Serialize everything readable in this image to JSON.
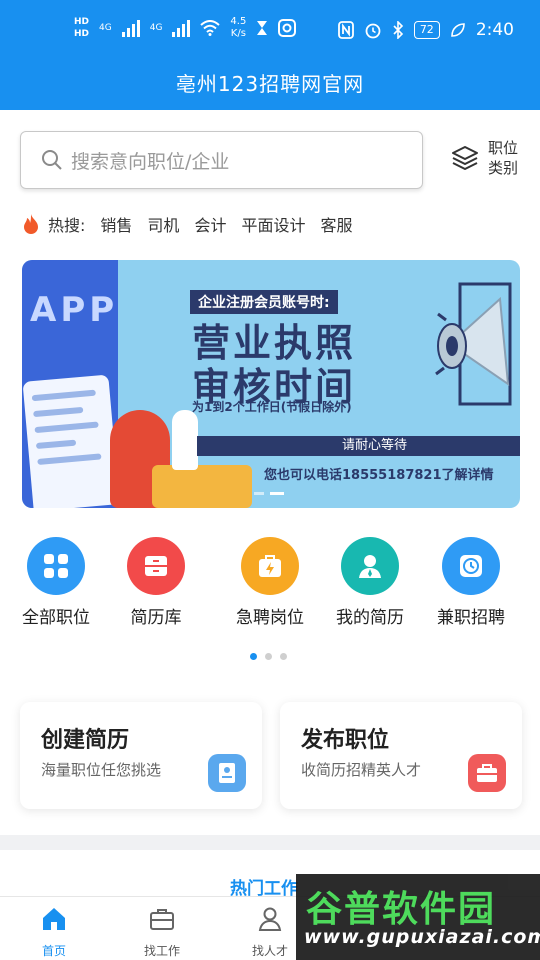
{
  "status_bar": {
    "hd1": "HD",
    "hd2": "HD",
    "net1": "4G",
    "net2": "4G",
    "speed_value": "4.5",
    "speed_unit": "K/s",
    "battery": "72",
    "time": "2:40"
  },
  "app_title": "亳州123招聘网官网",
  "search": {
    "placeholder": "搜索意向职位/企业"
  },
  "category_button": {
    "line1": "职位",
    "line2": "类别"
  },
  "hot_search": {
    "label": "热搜:",
    "tags": [
      "销售",
      "司机",
      "会计",
      "平面设计",
      "客服"
    ]
  },
  "banner": {
    "left_text": "APP",
    "headline_small": "企业注册会员账号时:",
    "headline_big1": "营业执照",
    "headline_big2": "审核时间",
    "subline": "为1到2个工作日(节假日除外)",
    "strip_text": "请耐心等待",
    "contact": "您也可以电话18555187821了解详情"
  },
  "menu": [
    {
      "label": "全部职位",
      "icon": "grid-icon",
      "color": "#2f9bf5"
    },
    {
      "label": "简历库",
      "icon": "drawer-icon",
      "color": "#f24a4a"
    },
    {
      "label": "急聘岗位",
      "icon": "lightning-bag-icon",
      "color": "#f7a823"
    },
    {
      "label": "我的简历",
      "icon": "person-icon",
      "color": "#18b8b0"
    },
    {
      "label": "兼职招聘",
      "icon": "clock-icon",
      "color": "#2f9bf5"
    }
  ],
  "cards": [
    {
      "title": "创建简历",
      "subtitle": "海量职位任您挑选",
      "icon": "resume-icon",
      "color": "#5aa8ee"
    },
    {
      "title": "发布职位",
      "subtitle": "收简历招精英人才",
      "icon": "briefcase-icon",
      "color": "#f05a5a"
    }
  ],
  "section": {
    "title": "热门工作"
  },
  "tabs": [
    {
      "label": "首页",
      "icon": "home-icon",
      "active": true
    },
    {
      "label": "找工作",
      "icon": "briefcase-icon"
    },
    {
      "label": "找人才",
      "icon": "people-icon"
    }
  ],
  "watermark": {
    "cn": "谷普软件园",
    "url": "www.gupuxiazai.com"
  },
  "colors": {
    "primary": "#1890f0"
  }
}
